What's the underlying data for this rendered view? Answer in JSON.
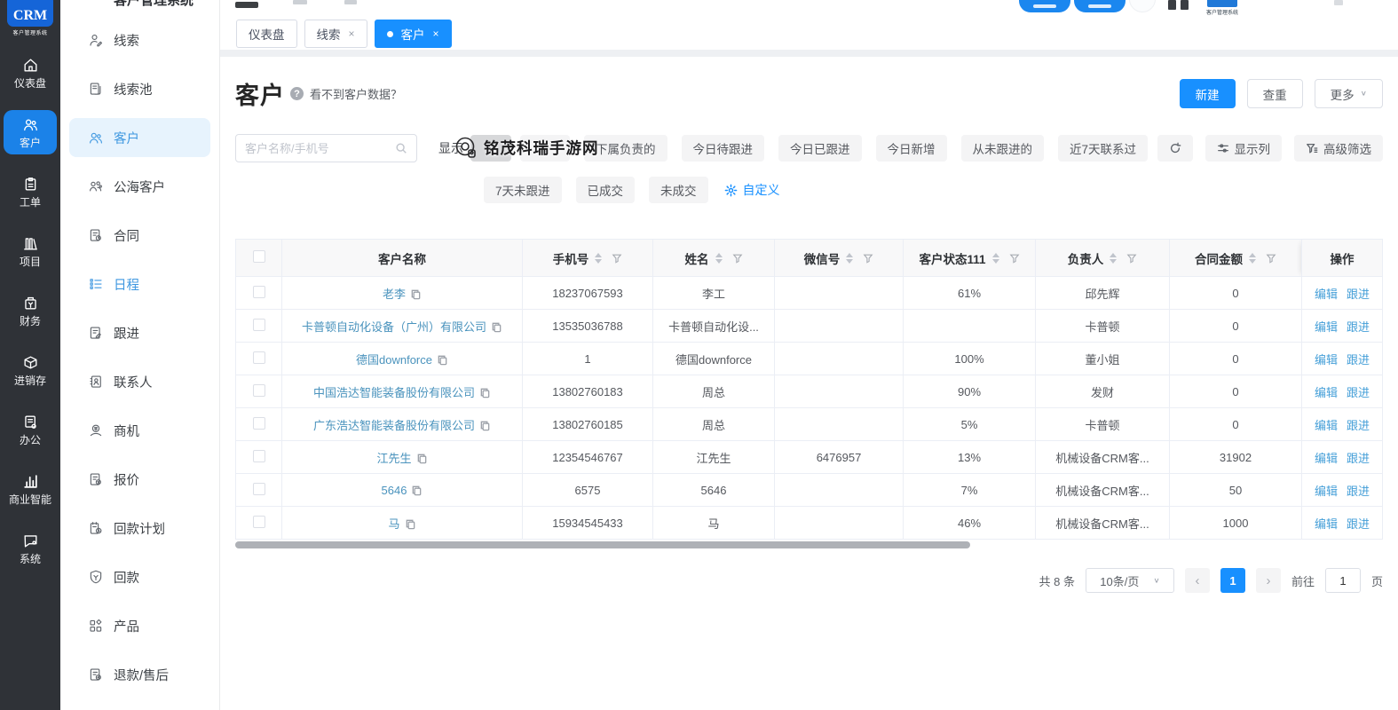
{
  "app": {
    "logo_text": "CRM",
    "logo_subtitle": "客户管理系统"
  },
  "sidebar": {
    "primary": [
      {
        "icon": "home-icon",
        "label": "仪表盘",
        "active": false
      },
      {
        "icon": "users-icon",
        "label": "客户",
        "active": true
      },
      {
        "icon": "workorder-icon",
        "label": "工单",
        "active": false
      },
      {
        "icon": "project-icon",
        "label": "项目",
        "active": false
      },
      {
        "icon": "finance-icon",
        "label": "财务",
        "active": false
      },
      {
        "icon": "inventory-icon",
        "label": "进销存",
        "active": false
      },
      {
        "icon": "office-icon",
        "label": "办公",
        "active": false
      },
      {
        "icon": "bi-icon",
        "label": "商业智能",
        "active": false
      },
      {
        "icon": "system-icon",
        "label": "系统",
        "active": false
      }
    ],
    "secondary": [
      {
        "icon": "lead-icon",
        "label": "线索"
      },
      {
        "icon": "lead-pool-icon",
        "label": "线索池"
      },
      {
        "icon": "customer-icon",
        "label": "客户",
        "active": true
      },
      {
        "icon": "public-customer-icon",
        "label": "公海客户"
      },
      {
        "icon": "contract-icon",
        "label": "合同"
      },
      {
        "icon": "schedule-icon",
        "label": "日程",
        "highlight": true
      },
      {
        "icon": "followup-icon",
        "label": "跟进"
      },
      {
        "icon": "contact-icon",
        "label": "联系人"
      },
      {
        "icon": "opportunity-icon",
        "label": "商机"
      },
      {
        "icon": "quote-icon",
        "label": "报价"
      },
      {
        "icon": "payment-plan-icon",
        "label": "回款计划"
      },
      {
        "icon": "payment-icon",
        "label": "回款"
      },
      {
        "icon": "product-icon",
        "label": "产品"
      },
      {
        "icon": "refund-icon",
        "label": "退款/售后"
      }
    ]
  },
  "tabs": [
    {
      "label": "仪表盘",
      "closable": false,
      "active": false
    },
    {
      "label": "线索",
      "closable": true,
      "active": false
    },
    {
      "label": "客户",
      "closable": true,
      "active": true
    }
  ],
  "page": {
    "title": "客户",
    "help_text": "看不到客户数据？"
  },
  "actions": {
    "create": "新建",
    "dedupe": "查重",
    "more": "更多"
  },
  "toolbar": {
    "search_placeholder": "客户名称/手机号",
    "show_label": "显示",
    "filters": [
      "下属负责的",
      "今日待跟进",
      "今日已跟进",
      "今日新增",
      "从未跟进的",
      "近7天联系过"
    ],
    "filters_row2": [
      "7天未跟进",
      "已成交",
      "未成交"
    ],
    "custom_label": "自定义",
    "display_columns_label": "显示列",
    "advanced_filter_label": "高级筛选"
  },
  "watermark": {
    "text": "铭茂科瑞手游网"
  },
  "table": {
    "columns": [
      {
        "label": "客户名称",
        "sortable": false
      },
      {
        "label": "手机号",
        "sortable": true
      },
      {
        "label": "姓名",
        "sortable": true
      },
      {
        "label": "微信号",
        "sortable": true
      },
      {
        "label": "客户状态111",
        "sortable": true
      },
      {
        "label": "负责人",
        "sortable": true
      },
      {
        "label": "合同金额",
        "sortable": true
      },
      {
        "label": "操作",
        "sortable": false
      }
    ],
    "action_labels": [
      "编辑",
      "跟进"
    ],
    "rows": [
      {
        "name": "老李",
        "phone": "18237067593",
        "contact": "李工",
        "wechat": "",
        "status": "61%",
        "owner": "邱先辉",
        "amount": "0"
      },
      {
        "name": "卡普顿自动化设备（广州）有限公司",
        "phone": "13535036788",
        "contact": "卡普顿自动化设...",
        "wechat": "",
        "status": "",
        "owner": "卡普顿",
        "amount": "0"
      },
      {
        "name": "德国downforce",
        "phone": "1",
        "contact": "德国downforce",
        "wechat": "",
        "status": "100%",
        "owner": "董小姐",
        "amount": "0"
      },
      {
        "name": "中国浩达智能装备股份有限公司",
        "phone": "13802760183",
        "contact": "周总",
        "wechat": "",
        "status": "90%",
        "owner": "发财",
        "amount": "0"
      },
      {
        "name": "广东浩达智能装备股份有限公司",
        "phone": "13802760185",
        "contact": "周总",
        "wechat": "",
        "status": "5%",
        "owner": "卡普顿",
        "amount": "0"
      },
      {
        "name": "江先生",
        "phone": "12354546767",
        "contact": "江先生",
        "wechat": "6476957",
        "status": "13%",
        "owner": "机械设备CRM客...",
        "amount": "31902"
      },
      {
        "name": "5646",
        "phone": "6575",
        "contact": "5646",
        "wechat": "",
        "status": "7%",
        "owner": "机械设备CRM客...",
        "amount": "50"
      },
      {
        "name": "马",
        "phone": "15934545433",
        "contact": "马",
        "wechat": "",
        "status": "46%",
        "owner": "机械设备CRM客...",
        "amount": "1000"
      }
    ]
  },
  "pagination": {
    "total": "共 8 条",
    "page_size": "10条/页",
    "current_page": "1",
    "goto_label": "前往",
    "goto_value": "1",
    "page_unit": "页"
  },
  "colors": {
    "primary": "#1890ff",
    "link": "#4a93bd",
    "sidebar_bg": "#2f3237",
    "active_nav_bg": "#e7f3fd"
  }
}
